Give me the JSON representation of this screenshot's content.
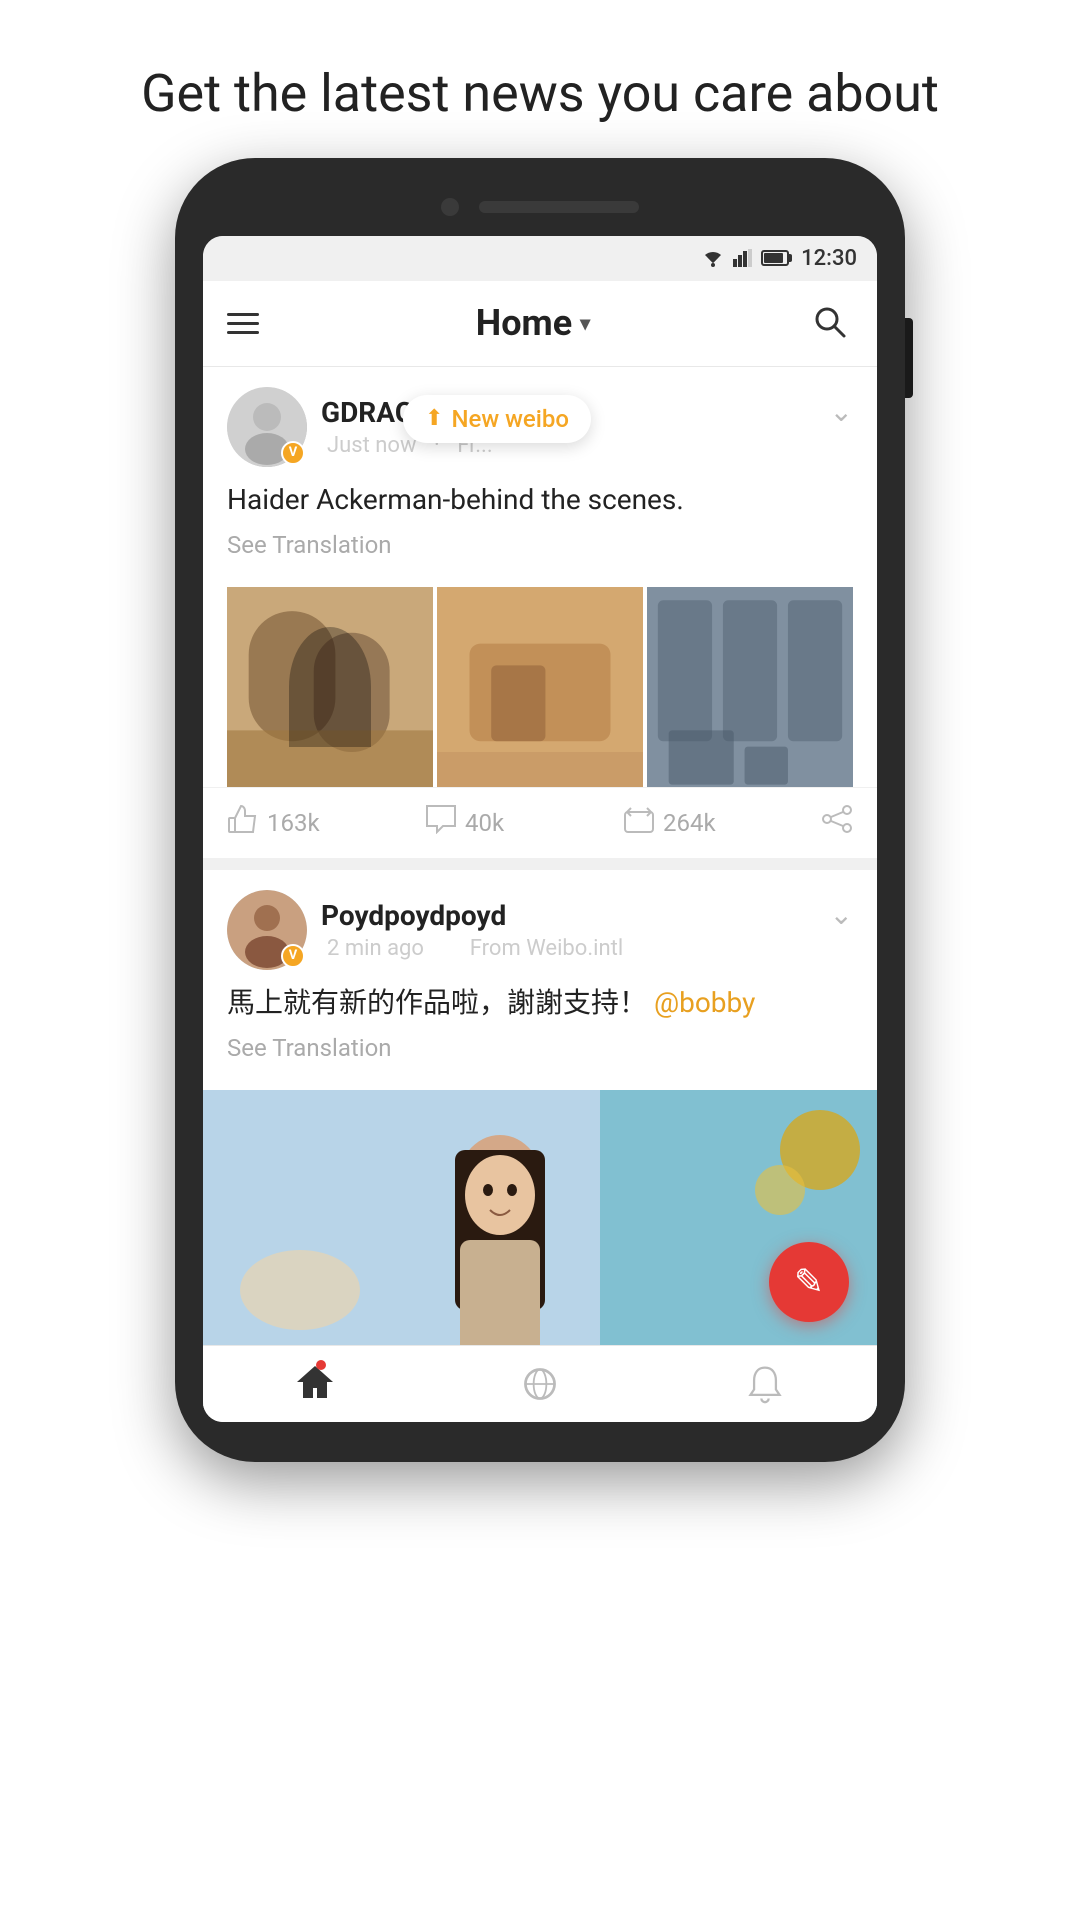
{
  "page": {
    "heading": "Get the latest news you care about"
  },
  "status_bar": {
    "time": "12:30"
  },
  "app_header": {
    "menu_icon": "hamburger-menu",
    "title": "Home",
    "dropdown_icon": "▾",
    "search_icon": "search"
  },
  "posts": [
    {
      "id": "post_1",
      "username": "GDRAGON",
      "time": "Just now",
      "from": "Fr...",
      "verified": true,
      "badge_label": "V",
      "text": "Haider Ackerman-behind the scenes.",
      "see_translation": "See Translation",
      "new_weibo_label": "New weibo",
      "images": [
        "img1",
        "img2",
        "img3"
      ],
      "likes": "163k",
      "comments": "40k",
      "reposts": "264k"
    },
    {
      "id": "post_2",
      "username": "Poydpoydpoyd",
      "time": "2 min ago",
      "from": "From Weibo.intl",
      "verified": true,
      "badge_label": "V",
      "text": "馬上就有新的作品啦，謝謝支持！",
      "mention": "@bobby",
      "see_translation": "See Translation"
    }
  ],
  "fab": {
    "icon": "✎",
    "label": "compose"
  },
  "bottom_nav": {
    "items": [
      {
        "icon": "home",
        "label": "Home",
        "active": true,
        "has_dot": true
      },
      {
        "icon": "explore",
        "label": "Explore",
        "active": false,
        "has_dot": false
      },
      {
        "icon": "notifications",
        "label": "Notifications",
        "active": false,
        "has_dot": false
      }
    ]
  }
}
